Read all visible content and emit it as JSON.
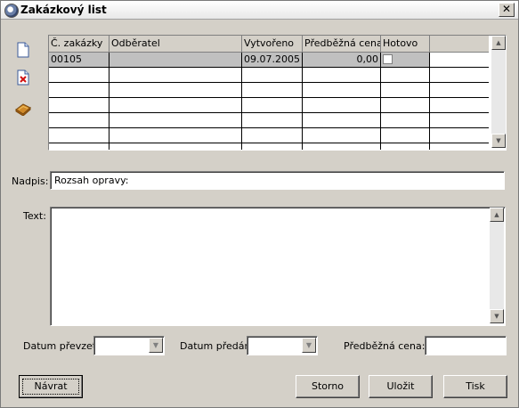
{
  "window": {
    "title": "Zakázkový list",
    "close_glyph": "✕"
  },
  "toolbar": {
    "icons": [
      "new-document-icon",
      "delete-document-icon",
      "book-icon"
    ]
  },
  "grid": {
    "columns": [
      "Č. zakázky",
      "Odběratel",
      "Vytvořeno",
      "Předběžná cena",
      "Hotovo"
    ],
    "rows": [
      {
        "cislo": "00105",
        "odberatel": "",
        "vytvoreno": "09.07.2005",
        "cena": "0,00",
        "hotovo": false
      }
    ]
  },
  "form": {
    "nadpis_label": "Nadpis:",
    "nadpis_value": "Rozsah opravy:",
    "text_label": "Text:",
    "text_value": "",
    "datum_prevzeti_label": "Datum převzetí:",
    "datum_prevzeti_value": "",
    "datum_predani_label": "Datum předání:",
    "datum_predani_value": "",
    "predbezna_cena_label": "Předběžná cena:",
    "predbezna_cena_value": ""
  },
  "buttons": {
    "navrat": "Návrat",
    "storno": "Storno",
    "ulozit": "Uložit",
    "tisk": "Tisk"
  },
  "colors": {
    "window_bg": "#d4d0c8",
    "selected_row": "#c0c0c0"
  }
}
